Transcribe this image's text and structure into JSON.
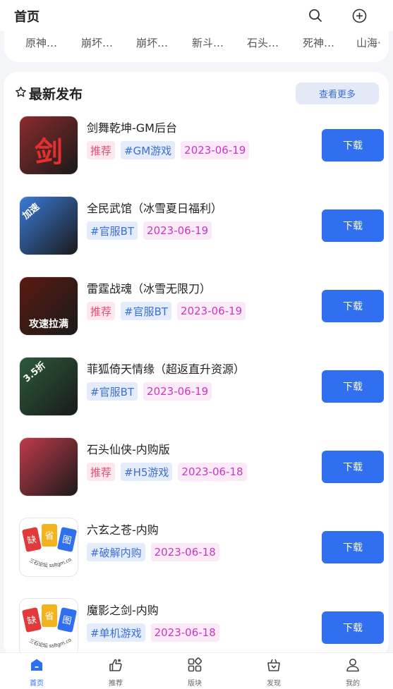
{
  "header": {
    "title": "首页",
    "search_icon": "search-icon",
    "add_icon": "plus-circle-icon"
  },
  "categories": [
    "原神…",
    "崩坏…",
    "崩坏…",
    "新斗…",
    "石头…",
    "死神…",
    "山海·"
  ],
  "section": {
    "title": "最新发布",
    "icon": "star-outline-icon",
    "more_label": "查看更多"
  },
  "download_label": "下载",
  "apps": [
    {
      "name": "剑舞乾坤-GM后台",
      "recommended": "推荐",
      "category": "#GM游戏",
      "date": "2023-06-19",
      "icon_badge": "剑",
      "icon_color": "#8c2b2b"
    },
    {
      "name": "全民武馆（冰雪夏日福利）",
      "recommended": "",
      "category": "#官服BT",
      "date": "2023-06-19",
      "icon_badge": "加速",
      "icon_color": "#3a7ad6"
    },
    {
      "name": "雷霆战魂（冰雪无限刀）",
      "recommended": "推荐",
      "category": "#官服BT",
      "date": "2023-06-19",
      "icon_badge": "攻速拉满",
      "icon_color": "#5a1a10"
    },
    {
      "name": "菲狐倚天情缘（超返直升资源）",
      "recommended": "",
      "category": "#官服BT",
      "date": "2023-06-19",
      "icon_badge": "3.5折",
      "icon_color": "#2c5a3a"
    },
    {
      "name": "石头仙侠-内购版",
      "recommended": "推荐",
      "category": "#H5游戏",
      "date": "2023-06-18",
      "icon_badge": "",
      "icon_color": "#c23a4a"
    },
    {
      "name": "六玄之苍-内购",
      "recommended": "",
      "category": "#破解内购",
      "date": "2023-06-18",
      "icon_badge": "缺省图",
      "icon_color": "#ffffff"
    },
    {
      "name": "魔影之剑-内购",
      "recommended": "",
      "category": "#单机游戏",
      "date": "2023-06-18",
      "icon_badge": "缺省图",
      "icon_color": "#ffffff"
    }
  ],
  "placeholder_icon_text": {
    "c1": "缺",
    "c2": "省",
    "c3": "图",
    "footer": "三石论坛 ssltgm.com"
  },
  "bottom_nav": [
    {
      "label": "首页",
      "icon": "home-icon",
      "active": true
    },
    {
      "label": "推荐",
      "icon": "thumbs-up-icon",
      "active": false
    },
    {
      "label": "版块",
      "icon": "grid-icon",
      "active": false
    },
    {
      "label": "发现",
      "icon": "discover-icon",
      "active": false
    },
    {
      "label": "我的",
      "icon": "user-icon",
      "active": false
    }
  ],
  "colors": {
    "accent": "#2f6ff0",
    "recommend_tag": "#e24c7a",
    "category_tag": "#3b6fd8",
    "date_tag": "#c43ac0"
  }
}
